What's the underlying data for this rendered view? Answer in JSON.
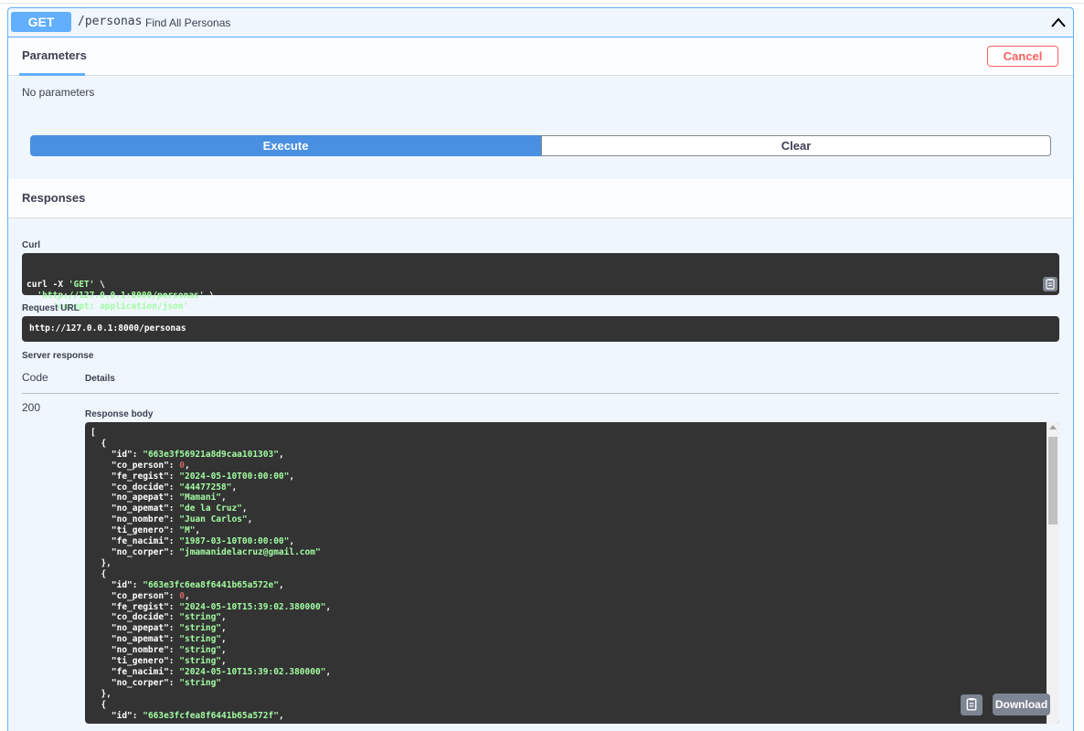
{
  "operation": {
    "method": "GET",
    "path": "/personas",
    "summary": "Find All Personas",
    "color": "#61affe"
  },
  "parameters": {
    "tab_label": "Parameters",
    "cancel_label": "Cancel",
    "empty_text": "No parameters"
  },
  "actions": {
    "execute_label": "Execute",
    "clear_label": "Clear"
  },
  "responses": {
    "title": "Responses",
    "curl_label": "Curl",
    "curl_lines": [
      {
        "a": "curl -X ",
        "b": "'GET'",
        "c": " \\"
      },
      {
        "a": "  ",
        "b": "'http://127.0.0.1:8000/personas'",
        "c": " \\"
      },
      {
        "a": "  -H ",
        "b": "'accept: application/json'",
        "c": ""
      }
    ],
    "request_url_label": "Request URL",
    "request_url": "http://127.0.0.1:8000/personas",
    "server_response_label": "Server response",
    "code_header": "Code",
    "details_header": "Details",
    "status_code": "200",
    "response_body_label": "Response body",
    "download_label": "Download"
  },
  "response_body": [
    {
      "t": "p",
      "v": "["
    },
    {
      "t": "p",
      "v": "  {"
    },
    {
      "t": "kv",
      "k": "\"id\"",
      "v": "\"663e3f56921a8d9caa101303\"",
      "end": ","
    },
    {
      "t": "kn",
      "k": "\"co_person\"",
      "v": "0",
      "end": ","
    },
    {
      "t": "kv",
      "k": "\"fe_regist\"",
      "v": "\"2024-05-10T00:00:00\"",
      "end": ","
    },
    {
      "t": "kv",
      "k": "\"co_docide\"",
      "v": "\"44477258\"",
      "end": ","
    },
    {
      "t": "kv",
      "k": "\"no_apepat\"",
      "v": "\"Mamani\"",
      "end": ","
    },
    {
      "t": "kv",
      "k": "\"no_apemat\"",
      "v": "\"de la Cruz\"",
      "end": ","
    },
    {
      "t": "kv",
      "k": "\"no_nombre\"",
      "v": "\"Juan Carlos\"",
      "end": ","
    },
    {
      "t": "kv",
      "k": "\"ti_genero\"",
      "v": "\"M\"",
      "end": ","
    },
    {
      "t": "kv",
      "k": "\"fe_nacimi\"",
      "v": "\"1987-03-10T00:00:00\"",
      "end": ","
    },
    {
      "t": "kv",
      "k": "\"no_corper\"",
      "v": "\"jmamanidelacruz@gmail.com\"",
      "end": ""
    },
    {
      "t": "p",
      "v": "  },"
    },
    {
      "t": "p",
      "v": "  {"
    },
    {
      "t": "kv",
      "k": "\"id\"",
      "v": "\"663e3fc6ea8f6441b65a572e\"",
      "end": ","
    },
    {
      "t": "kn",
      "k": "\"co_person\"",
      "v": "0",
      "end": ","
    },
    {
      "t": "kv",
      "k": "\"fe_regist\"",
      "v": "\"2024-05-10T15:39:02.380000\"",
      "end": ","
    },
    {
      "t": "kv",
      "k": "\"co_docide\"",
      "v": "\"string\"",
      "end": ","
    },
    {
      "t": "kv",
      "k": "\"no_apepat\"",
      "v": "\"string\"",
      "end": ","
    },
    {
      "t": "kv",
      "k": "\"no_apemat\"",
      "v": "\"string\"",
      "end": ","
    },
    {
      "t": "kv",
      "k": "\"no_nombre\"",
      "v": "\"string\"",
      "end": ","
    },
    {
      "t": "kv",
      "k": "\"ti_genero\"",
      "v": "\"string\"",
      "end": ","
    },
    {
      "t": "kv",
      "k": "\"fe_nacimi\"",
      "v": "\"2024-05-10T15:39:02.380000\"",
      "end": ","
    },
    {
      "t": "kv",
      "k": "\"no_corper\"",
      "v": "\"string\"",
      "end": ""
    },
    {
      "t": "p",
      "v": "  },"
    },
    {
      "t": "p",
      "v": "  {"
    },
    {
      "t": "kv",
      "k": "\"id\"",
      "v": "\"663e3fcfea8f6441b65a572f\"",
      "end": ","
    }
  ]
}
